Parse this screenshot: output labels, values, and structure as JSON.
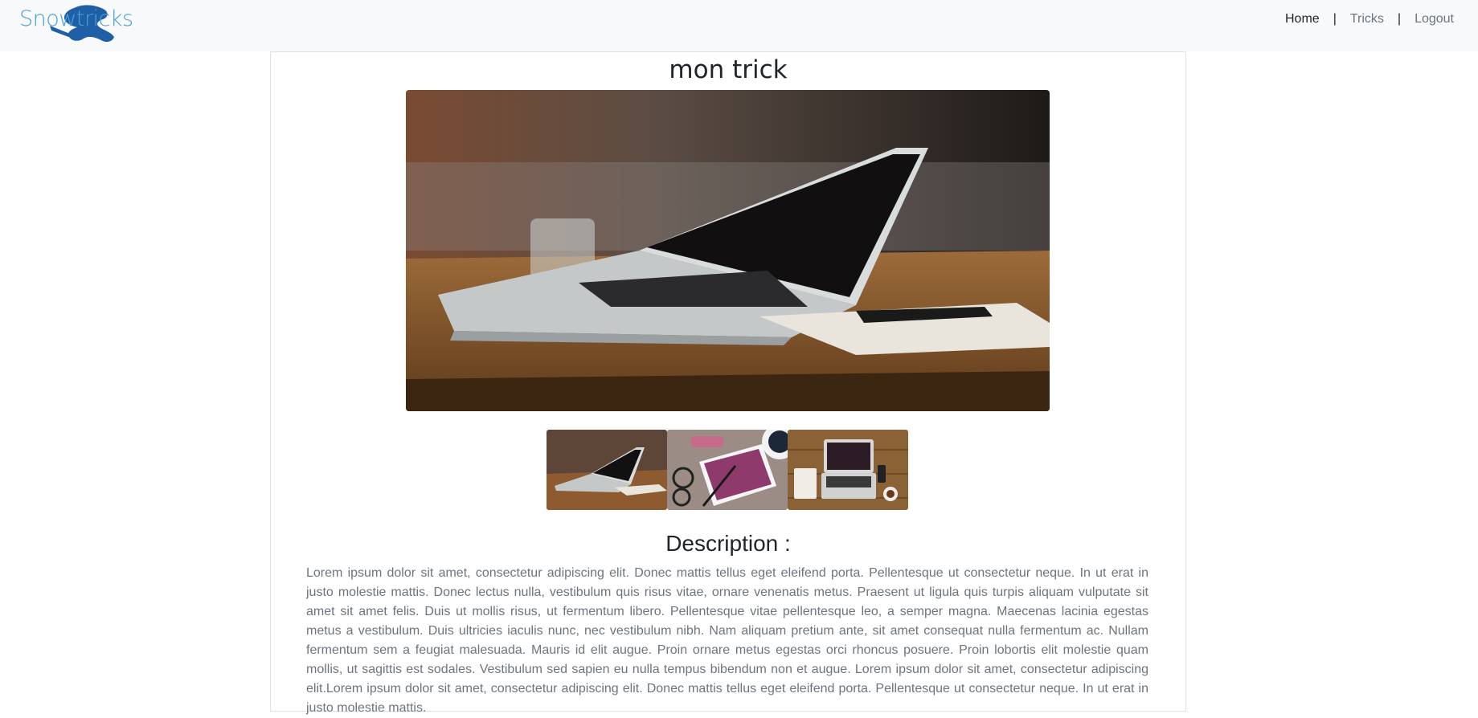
{
  "navbar": {
    "brand": "Snowtricks",
    "links": [
      {
        "label": "Home",
        "active": true
      },
      {
        "label": "Tricks",
        "active": false
      },
      {
        "label": "Logout",
        "active": false
      }
    ],
    "separator": "|"
  },
  "trick": {
    "title": "mon trick",
    "main_image": "laptop on wooden table",
    "thumbnails": [
      "laptop on wooden table",
      "tablet with glasses and pen",
      "laptop top view on desk"
    ],
    "description_heading": "Description :",
    "description": "Lorem ipsum dolor sit amet, consectetur adipiscing elit. Donec mattis tellus eget eleifend porta. Pellentesque ut consectetur neque. In ut erat in justo molestie mattis. Donec lectus nulla, vestibulum quis risus vitae, ornare venenatis metus. Praesent ut ligula quis turpis aliquam vulputate sit amet sit amet felis. Duis ut mollis risus, ut fermentum libero. Pellentesque vitae pellentesque leo, a semper magna. Maecenas lacinia egestas metus a vestibulum. Duis ultricies iaculis nunc, nec vestibulum nibh. Nam aliquam pretium ante, sit amet consequat nulla fermentum ac. Nullam fermentum sem a feugiat malesuada. Mauris id elit augue. Proin ornare metus egestas orci rhoncus posuere. Proin lobortis elit molestie quam mollis, ut sagittis est sodales. Vestibulum sed sapien eu nulla tempus bibendum non et augue. Lorem ipsum dolor sit amet, consectetur adipiscing elit.Lorem ipsum dolor sit amet, consectetur adipiscing elit. Donec mattis tellus eget eleifend porta. Pellentesque ut consectetur neque. In ut erat in justo molestie mattis."
  },
  "colors": {
    "brand": "#4aa0d8",
    "navbar_bg": "#f8f9fa",
    "muted_text": "#6c757d",
    "border": "#dee2e6"
  }
}
